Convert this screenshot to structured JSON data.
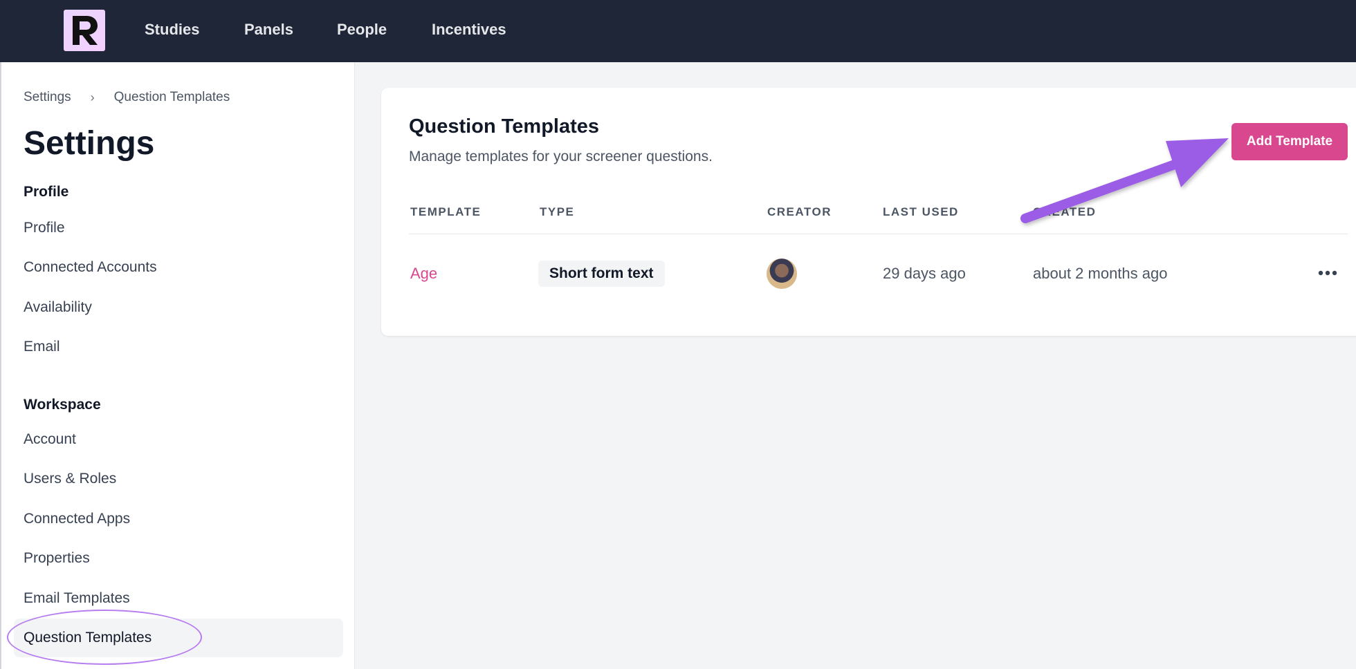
{
  "nav": {
    "items": [
      {
        "label": "Studies"
      },
      {
        "label": "Panels"
      },
      {
        "label": "People"
      },
      {
        "label": "Incentives"
      }
    ]
  },
  "breadcrumb": {
    "root": "Settings",
    "current": "Question Templates"
  },
  "sidebar": {
    "title": "Settings",
    "profile_heading": "Profile",
    "profile_items": [
      "Profile",
      "Connected Accounts",
      "Availability",
      "Email"
    ],
    "workspace_heading": "Workspace",
    "workspace_items": [
      "Account",
      "Users & Roles",
      "Connected Apps",
      "Properties",
      "Email Templates",
      "Question Templates"
    ],
    "active_item": "Question Templates"
  },
  "main": {
    "title": "Question Templates",
    "subtitle": "Manage templates for your screener questions.",
    "add_button_label": "Add Template",
    "table": {
      "columns": [
        "TEMPLATE",
        "TYPE",
        "CREATOR",
        "LAST USED",
        "CREATED"
      ],
      "rows": [
        {
          "template": "Age",
          "type": "Short form text",
          "creator_icon": "avatar",
          "last_used": "29 days ago",
          "created": "about 2 months ago"
        }
      ]
    }
  },
  "colors": {
    "topbar": "#1f2637",
    "accent": "#d9478f",
    "annotation": "#9b5de5"
  }
}
